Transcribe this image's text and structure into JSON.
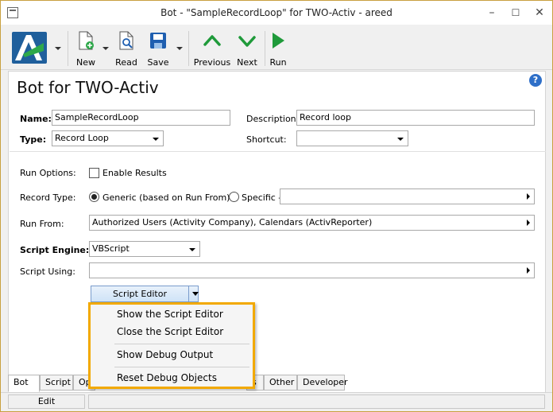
{
  "window": {
    "title": "Bot - \"SampleRecordLoop\" for TWO-Activ - areed",
    "minimize": "–",
    "maximize": "☐",
    "close": "✕"
  },
  "toolbar": {
    "new_label": "New",
    "read_label": "Read",
    "save_label": "Save",
    "previous_label": "Previous",
    "next_label": "Next",
    "run_label": "Run"
  },
  "form": {
    "heading": "Bot for TWO-Activ",
    "help": "?",
    "name_label": "Name:",
    "name_value": "SampleRecordLoop",
    "description_label": "Description:",
    "description_value": "Record loop",
    "type_label": "Type:",
    "type_value": "Record Loop",
    "shortcut_label": "Shortcut:",
    "shortcut_value": "",
    "run_options_label": "Run Options:",
    "enable_results_label": "Enable Results",
    "record_type_label": "Record Type:",
    "generic_label": "Generic (based on Run From)",
    "specific_label": "Specific -",
    "specific_value": "",
    "run_from_label": "Run From:",
    "run_from_value": "Authorized Users (Activity Company), Calendars (ActivReporter)",
    "script_engine_label": "Script Engine:",
    "script_engine_value": "VBScript",
    "script_using_label": "Script Using:",
    "script_using_value": "",
    "script_editor_label": "Script Editor"
  },
  "menu": {
    "items": [
      "Show the Script Editor",
      "Close the Script Editor",
      "Show Debug Output",
      "Reset Debug Objects"
    ]
  },
  "tabs": {
    "bot": "Bot",
    "script": "Script",
    "op": "Op",
    "s": "s",
    "other": "Other",
    "developer": "Developer"
  },
  "status": {
    "mode": "Edit"
  },
  "colors": {
    "menu_highlight_border": "#f2a900",
    "accent_green": "#1f9a3a",
    "save_blue": "#1f5fb0",
    "help_blue": "#2e6fc8"
  }
}
